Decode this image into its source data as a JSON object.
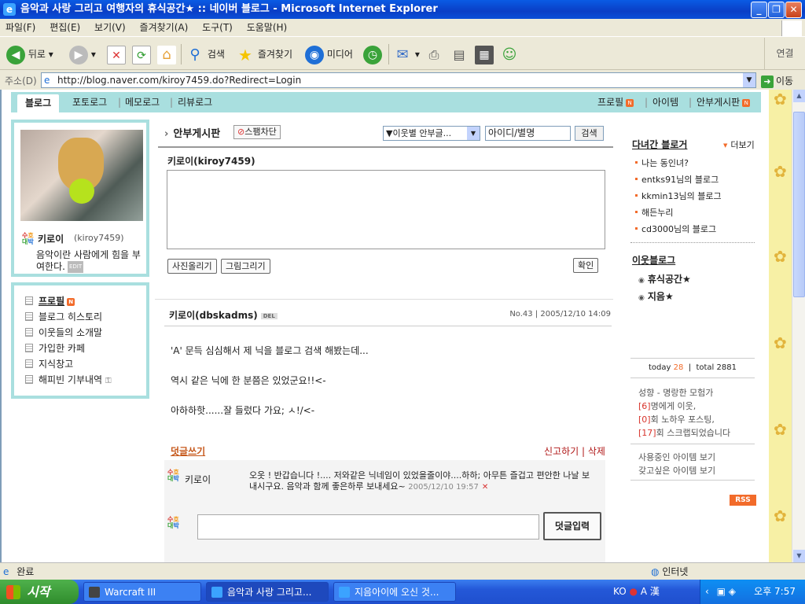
{
  "window": {
    "title": "음악과 사랑 그리고 여행자의 휴식공간★ :: 네이버 블로그 - Microsoft Internet Explorer",
    "min_icon": "minimize-icon",
    "max_icon": "maximize-icon",
    "close_icon": "close-icon"
  },
  "menu": [
    "파일(F)",
    "편집(E)",
    "보기(V)",
    "즐겨찾기(A)",
    "도구(T)",
    "도움말(H)"
  ],
  "toolbar": {
    "back": "뒤로",
    "search": "검색",
    "favorites": "즐겨찾기",
    "media": "미디어",
    "links": "연결"
  },
  "address": {
    "label": "주소(D)",
    "url": "http://blog.naver.com/kiroy7459.do?Redirect=Login",
    "go": "이동"
  },
  "blog": {
    "tabs": [
      "블로그",
      "포토로그",
      "메모로그",
      "리뷰로그"
    ],
    "right_tabs": [
      "프로필",
      "아이템",
      "안부게시판"
    ],
    "new_badge": "N",
    "profile": {
      "nickname": "키로이",
      "id": "(kiroy7459)",
      "intro": "음악이란 사람에게 힘을 부여한다.",
      "edit": "EDIT",
      "logo_text": "수호대박"
    },
    "side_menu": [
      "프로필",
      "블로그 히스토리",
      "이웃들의 소개말",
      "가입한 카페",
      "지식창고",
      "해피빈 기부내역"
    ],
    "guestbook": {
      "title": "안부게시판",
      "spam_block": "스팸차단",
      "select_value": "▼이웃별 안부글...",
      "search_input": "아이디/별명",
      "search_btn": "검색",
      "writer": "키로이(kiroy7459)",
      "photo_btn": "사진올리기",
      "draw_btn": "그림그리기",
      "ok_btn": "확인"
    },
    "post": {
      "author": "키로이(dbskadms)",
      "del": "DEL",
      "meta": "No.43 | 2005/12/10 14:09",
      "lines": [
        "'A' 문득 심심해서 제 닉을 블로그 검색 해봤는데...",
        "역시 같은 닉에 한 분쯤은 있었군요!!<-",
        "아하하핫......잘 들렀다 가요; ㅅ!/<-"
      ],
      "reply": "덧글쓰기",
      "report": "신고하기 | 삭제"
    },
    "comment": {
      "name": "키로이",
      "text": "오옷 ! 반갑습니다 !.... 저와같은 닉네임이 있었을줄이야....하하; 아무튼 즐겁고 편안한 나날 보내시구요. 음악과 함께 좋은하루 보내세요~",
      "date": "2005/12/10 19:57",
      "delete_icon": "x-icon",
      "submit": "덧글입력"
    },
    "right": {
      "visited_title": "다녀간 블로거",
      "more": "더보기",
      "visited": [
        "나는 동인녀?",
        "entks91님의 블로그",
        "kkmin13님의 블로그",
        "해든누리",
        "cd3000님의 블로그"
      ],
      "neighbor_title": "이웃블로그",
      "neighbors": [
        "휴식공간★",
        "지음★"
      ],
      "today_label": "today",
      "today": "28",
      "total_label": "total",
      "total": "2881",
      "status": [
        {
          "text": "성향 - 명랑한 모험가"
        },
        {
          "num": "[6]",
          "text": "명에게 이웃,"
        },
        {
          "num": "[0]",
          "text": "회 노하우 포스팅,"
        },
        {
          "num": "[17]",
          "text": "회 스크랩되었습니다"
        }
      ],
      "items_using": "사용중인 아이템 보기",
      "items_want": "갖고싶은 아이템 보기",
      "rss": "RSS"
    }
  },
  "status": {
    "left": "완료",
    "right": "인터넷"
  },
  "taskbar": {
    "start": "시작",
    "tasks": [
      "Warcraft III",
      "음악과 사랑 그리고...",
      "지음아이에 오신 것..."
    ],
    "lang": "KO",
    "ime": "A 漢",
    "clock": "오후 7:57"
  }
}
